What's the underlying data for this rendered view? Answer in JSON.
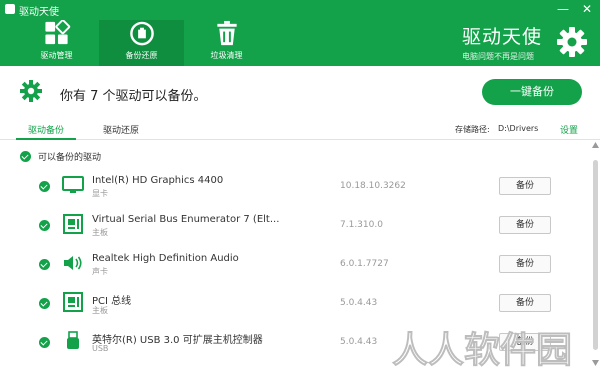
{
  "window": {
    "title": "驱动天使",
    "controls": {
      "minimize": "—",
      "close": "✕"
    }
  },
  "nav": {
    "items": [
      {
        "label": "驱动管理",
        "icon": "grid-icon"
      },
      {
        "label": "备份还原",
        "icon": "backup-restore-icon"
      },
      {
        "label": "垃圾清理",
        "icon": "trash-icon"
      }
    ]
  },
  "brand": {
    "name": "驱动天使",
    "tagline": "电脑问题不再是问题"
  },
  "summary": {
    "text": "你有 7 个驱动可以备份。",
    "backup_all_label": "一键备份"
  },
  "tabs": {
    "items": [
      "驱动备份",
      "驱动还原"
    ],
    "storage_label": "存储路径:",
    "storage_value": "D:\\Drivers",
    "settings_label": "设置"
  },
  "list": {
    "group_title": "可以备份的驱动",
    "rows": [
      {
        "name": "Intel(R) HD Graphics 4400",
        "category": "显卡",
        "version": "10.18.10.3262",
        "button": "备份",
        "icon": "monitor-icon"
      },
      {
        "name": "Virtual Serial Bus Enumerator 7 (Elt...",
        "category": "主板",
        "version": "7.1.310.0",
        "button": "备份",
        "icon": "motherboard-icon"
      },
      {
        "name": "Realtek High Definition Audio",
        "category": "声卡",
        "version": "6.0.1.7727",
        "button": "备份",
        "icon": "speaker-icon"
      },
      {
        "name": "PCI 总线",
        "category": "主板",
        "version": "5.0.4.43",
        "button": "备份",
        "icon": "motherboard-icon"
      },
      {
        "name": "英特尔(R) USB 3.0 可扩展主机控制器",
        "category": "USB",
        "version": "5.0.4.43",
        "button": "备份",
        "icon": "usb-icon"
      }
    ]
  },
  "watermark": {
    "text": "人人软件园"
  },
  "colors": {
    "accent": "#13a24a",
    "accent_dark": "#0f8e40"
  }
}
